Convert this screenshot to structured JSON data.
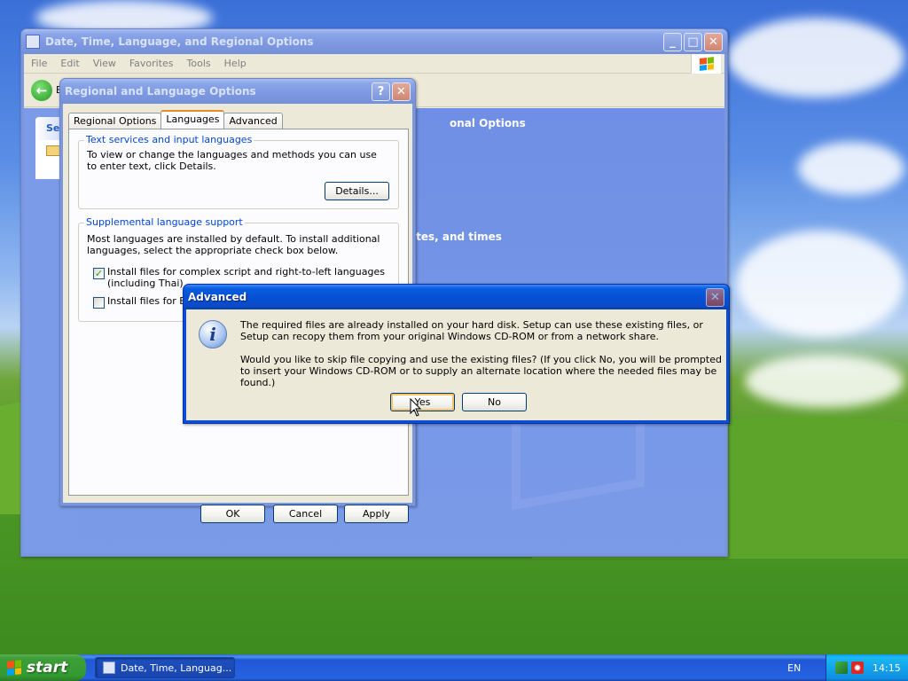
{
  "control_panel": {
    "title": "Date, Time, Language, and Regional Options",
    "menu": [
      "File",
      "Edit",
      "View",
      "Favorites",
      "Tools",
      "Help"
    ],
    "nav_back_label": "B",
    "left_panel_title": "Se",
    "header_fragment": "onal Options",
    "task_fragment": "ates, and times"
  },
  "regional_dialog": {
    "title": "Regional and Language Options",
    "tabs": [
      "Regional Options",
      "Languages",
      "Advanced"
    ],
    "active_tab": "Languages",
    "text_services": {
      "title": "Text services and input languages",
      "description": "To view or change the languages and methods you can use to enter text, click Details.",
      "details_button": "Details..."
    },
    "supplemental": {
      "title": "Supplemental language support",
      "description": "Most languages are installed by default. To install additional languages, select the appropriate check box below.",
      "complex_script_label": "Install files for complex script and right-to-left languages (including Thai)",
      "complex_script_checked": true,
      "east_asian_label": "Install files for East",
      "east_asian_checked": false
    },
    "ok_button": "OK",
    "cancel_button": "Cancel",
    "apply_button": "Apply"
  },
  "advanced_dialog": {
    "title": "Advanced",
    "message_1": "The required files are already installed on your hard disk. Setup can use these existing files, or Setup can recopy them from your original Windows CD-ROM or from a network share.",
    "message_2": "Would you like to skip file copying and use the existing files? (If you click No, you will be prompted to insert your Windows CD-ROM or to supply an alternate location where the needed files may be found.)",
    "yes_button": "Yes",
    "no_button": "No"
  },
  "taskbar": {
    "start_label": "start",
    "task_button_label": "Date, Time, Languag...",
    "language": "EN",
    "clock": "14:15"
  }
}
